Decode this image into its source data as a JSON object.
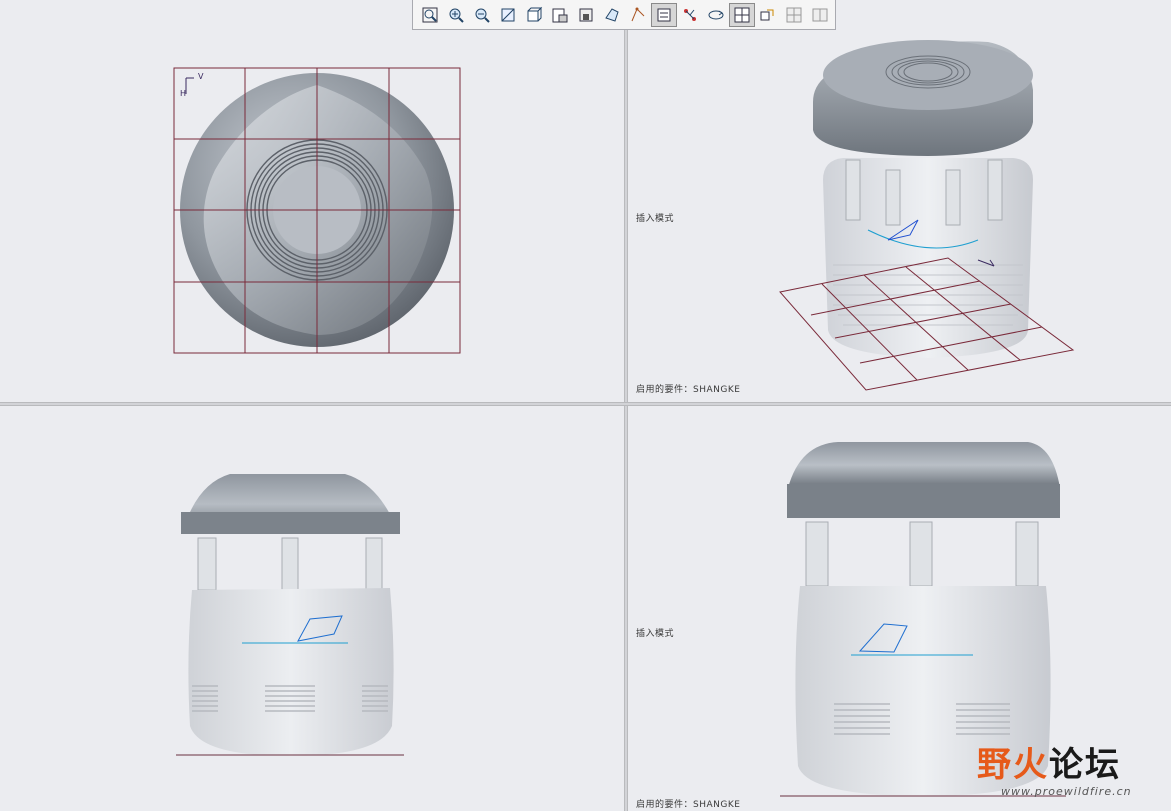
{
  "toolbar": {
    "buttons": [
      {
        "name": "refit-view-button",
        "icon": "zoom-fit-icon",
        "active": false
      },
      {
        "name": "zoom-in-button",
        "icon": "zoom-in-icon",
        "active": false
      },
      {
        "name": "zoom-out-button",
        "icon": "zoom-out-icon",
        "active": false
      },
      {
        "name": "repaint-button",
        "icon": "repaint-icon",
        "active": false
      },
      {
        "name": "display-style-button",
        "icon": "display-style-icon",
        "active": false
      },
      {
        "name": "saved-views-button",
        "icon": "saved-views-icon",
        "active": false
      },
      {
        "name": "view-manager-button",
        "icon": "view-manager-icon",
        "active": false
      },
      {
        "name": "perspective-button",
        "icon": "perspective-icon",
        "active": false
      },
      {
        "name": "datum-display-button",
        "icon": "datum-display-icon",
        "active": false
      },
      {
        "name": "annotation-display-button",
        "icon": "annotation-display-icon",
        "active": true
      },
      {
        "name": "spin-center-button",
        "icon": "spin-center-icon",
        "active": false
      },
      {
        "name": "orient-mode-button",
        "icon": "orient-mode-icon",
        "active": false
      },
      {
        "name": "multi-view-button",
        "icon": "multi-view-icon",
        "active": true
      },
      {
        "name": "sketch-view-button",
        "icon": "sketch-view-icon",
        "active": false
      },
      {
        "name": "grid-toggle-button",
        "icon": "grid-toggle-icon",
        "active": false
      },
      {
        "name": "show-panes-button",
        "icon": "show-panes-icon",
        "active": false
      }
    ]
  },
  "viewports": {
    "top_right": {
      "insert_mode": "插入模式",
      "enabled_feature": "启用的要件：SHANGKE"
    },
    "bottom_right": {
      "insert_mode": "插入模式",
      "enabled_feature": "启用的要件：SHANGKE"
    }
  },
  "watermark": {
    "title_part1": "野火",
    "title_part2": "论坛",
    "url": "www.proewildfire.cn"
  },
  "colors": {
    "grid": "#7a2a3a",
    "body": "#d9dbe0",
    "cap": "#8a9098",
    "sketch": "#1f6fd0",
    "axis": "#6a3040"
  }
}
